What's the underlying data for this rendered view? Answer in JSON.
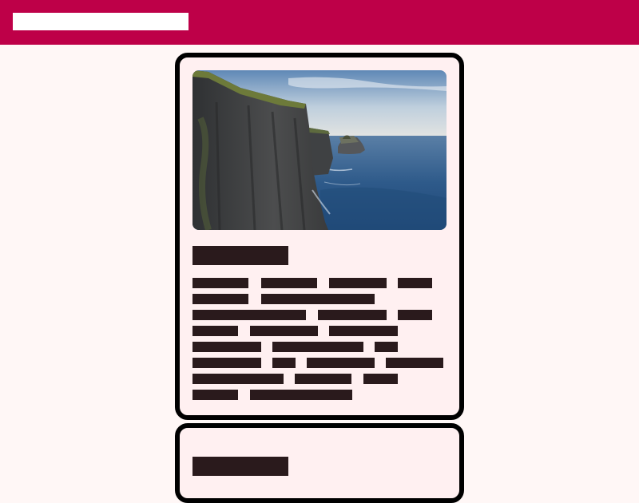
{
  "colors": {
    "brand": "#be0048",
    "page_bg": "#fff7f6",
    "card_bg": "#fff0f1",
    "card_border": "#000000",
    "redaction": "#2a1a1c"
  },
  "header": {
    "search_value": ""
  },
  "cards": [
    {
      "image": "coastal-cliffs-photo",
      "title": "",
      "body": ""
    },
    {
      "title": ""
    }
  ]
}
